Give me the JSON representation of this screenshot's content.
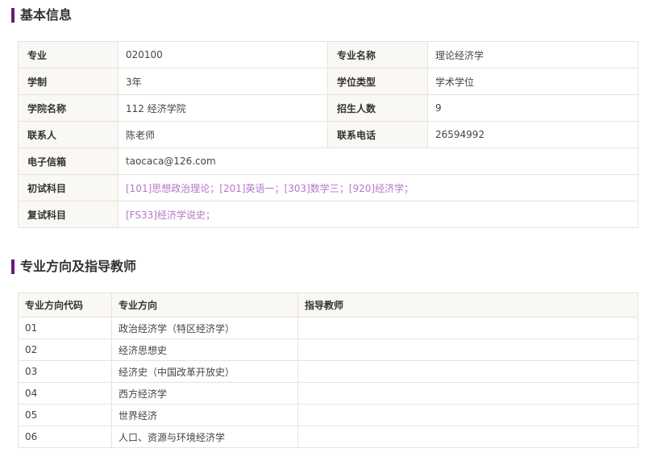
{
  "sections": {
    "basic_title": "基本信息",
    "direction_title": "专业方向及指导教师"
  },
  "basic_info": {
    "major_label": "专业",
    "major_value": "020100",
    "major_name_label": "专业名称",
    "major_name_value": "理论经济学",
    "duration_label": "学制",
    "duration_value": "3年",
    "degree_type_label": "学位类型",
    "degree_type_value": "学术学位",
    "college_label": "学院名称",
    "college_value": "112 经济学院",
    "enrollment_label": "招生人数",
    "enrollment_value": "9",
    "contact_label": "联系人",
    "contact_value": "陈老师",
    "phone_label": "联系电话",
    "phone_value": "26594992",
    "email_label": "电子信箱",
    "email_value": "taocaca@126.com",
    "initial_exam_label": "初试科目",
    "initial_exam_value": "[101]思想政治理论；[201]英语一；[303]数学三；[920]经济学；",
    "retest_label": "复试科目",
    "retest_value": "[FS33]经济学说史；"
  },
  "directions": {
    "headers": [
      "专业方向代码",
      "专业方向",
      "指导教师"
    ],
    "rows": [
      {
        "code": "01",
        "name": "政治经济学（特区经济学）",
        "advisor": ""
      },
      {
        "code": "02",
        "name": "经济思想史",
        "advisor": ""
      },
      {
        "code": "03",
        "name": "经济史（中国改革开放史）",
        "advisor": ""
      },
      {
        "code": "04",
        "name": "西方经济学",
        "advisor": ""
      },
      {
        "code": "05",
        "name": "世界经济",
        "advisor": ""
      },
      {
        "code": "06",
        "name": "人口、资源与环境经济学",
        "advisor": ""
      }
    ]
  },
  "colors": {
    "accent": "#6a1b7a",
    "link": "#b377c9",
    "label_bg": "#faf8f4",
    "border": "#e8e2da"
  }
}
